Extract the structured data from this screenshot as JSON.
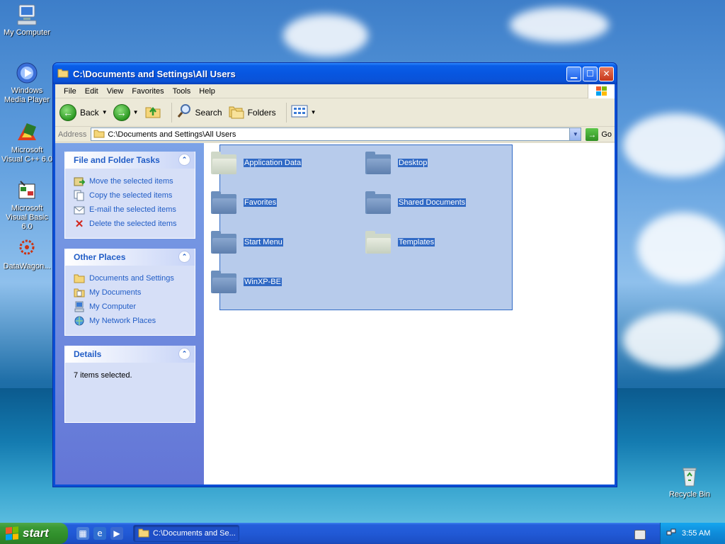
{
  "desktop": {
    "icons": [
      {
        "label": "My Computer"
      },
      {
        "label": "Windows Media Player"
      },
      {
        "label": "Microsoft Visual C++ 6.0"
      },
      {
        "label": "Microsoft Visual Basic 6.0"
      },
      {
        "label": "DataWagon..."
      },
      {
        "label": "Recycle Bin"
      }
    ]
  },
  "window": {
    "title": "C:\\Documents and Settings\\All Users",
    "menu": [
      "File",
      "Edit",
      "View",
      "Favorites",
      "Tools",
      "Help"
    ],
    "toolbar": {
      "back_label": "Back",
      "search_label": "Search",
      "folders_label": "Folders"
    },
    "address": {
      "label": "Address",
      "value": "C:\\Documents and Settings\\All Users",
      "go_label": "Go"
    },
    "tasks_panel": {
      "title": "File and Folder Tasks",
      "items": [
        {
          "label": "Move the selected items"
        },
        {
          "label": "Copy the selected items"
        },
        {
          "label": "E-mail the selected items"
        },
        {
          "label": "Delete the selected items"
        }
      ]
    },
    "places_panel": {
      "title": "Other Places",
      "items": [
        {
          "label": "Documents and Settings"
        },
        {
          "label": "My Documents"
        },
        {
          "label": "My Computer"
        },
        {
          "label": "My Network Places"
        }
      ]
    },
    "details_panel": {
      "title": "Details",
      "text": "7 items selected."
    },
    "folders": [
      {
        "label": "Application Data"
      },
      {
        "label": "Desktop"
      },
      {
        "label": "Favorites"
      },
      {
        "label": "Shared Documents"
      },
      {
        "label": "Start Menu"
      },
      {
        "label": "Templates"
      },
      {
        "label": "WinXP-BE"
      }
    ]
  },
  "taskbar": {
    "start_label": "start",
    "task_label": "C:\\Documents and Se...",
    "clock": "3:55 AM"
  }
}
